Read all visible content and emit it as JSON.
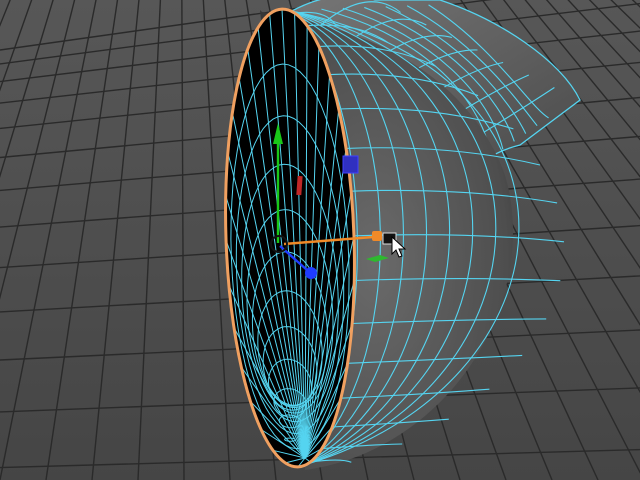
{
  "viewport": {
    "background": "#4f4f4f",
    "grid_color": "#2b2b2b",
    "wireframe_color": "#55d4f0",
    "selected_edge_color": "#f0a060",
    "mesh_shading": "#5a5a5a",
    "interior_color": "#000000"
  },
  "manipulator": {
    "y_axis_color": "#19c819",
    "z_axis_color": "#1f3cff",
    "x_handle_color": "#f08a28",
    "plane_handles": {
      "xy": "#3030c0",
      "yz": "#c02828",
      "xz": "#2fb82f"
    }
  },
  "icons": [
    "move-tool-icon",
    "mouse-cursor-icon"
  ]
}
